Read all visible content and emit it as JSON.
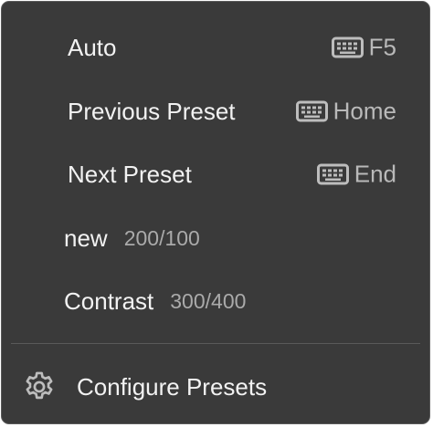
{
  "menu": {
    "items": [
      {
        "label": "Auto",
        "shortcut_key": "F5",
        "shortcut_icon": "keyboard-icon"
      },
      {
        "label": "Previous Preset",
        "shortcut_key": "Home",
        "shortcut_icon": "keyboard-icon"
      },
      {
        "label": "Next Preset",
        "shortcut_key": "End",
        "shortcut_icon": "keyboard-icon"
      }
    ],
    "presets": [
      {
        "label": "new",
        "value": "200/100"
      },
      {
        "label": "Contrast",
        "value": "300/400"
      }
    ],
    "configure": {
      "label": "Configure Presets",
      "icon": "gear-icon"
    }
  },
  "colors": {
    "background": "#3a3a3a",
    "text": "#f2f2f2",
    "secondary_text": "#aaaaaa",
    "icon": "#bdbdbd",
    "divider": "#5a5a5a"
  }
}
